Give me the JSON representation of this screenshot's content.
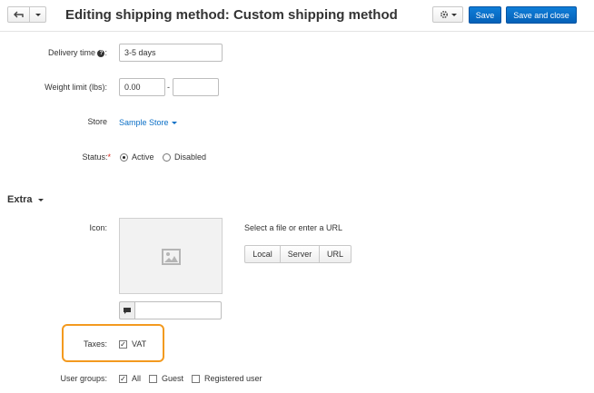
{
  "header": {
    "title": "Editing shipping method: Custom shipping method",
    "back_icon": "back-arrow-icon",
    "dropdown_icon": "chevron-down-icon",
    "settings_icon": "gear-icon",
    "save_label": "Save",
    "save_close_label": "Save and close",
    "accent_color": "#0561b8"
  },
  "form": {
    "delivery_time": {
      "label": "Delivery time",
      "value": "3-5 days",
      "help_icon": "question-icon"
    },
    "weight_limit": {
      "label": "Weight limit (lbs):",
      "from_value": "0.00",
      "separator": "-",
      "to_value": ""
    },
    "store": {
      "label": "Store",
      "value": "Sample Store"
    },
    "status": {
      "label": "Status:",
      "required_mark": "*",
      "options": [
        "Active",
        "Disabled"
      ],
      "selected": "Active"
    }
  },
  "extra": {
    "section_title": "Extra",
    "icon": {
      "label": "Icon:",
      "hint": "Select a file or enter a URL",
      "source_buttons": [
        "Local",
        "Server",
        "URL"
      ],
      "placeholder_icon": "image-icon",
      "alt_icon": "comment-icon",
      "alt_value": ""
    },
    "taxes": {
      "label": "Taxes:",
      "option": "VAT",
      "checked": true,
      "highlight_color": "#f39a1f"
    },
    "user_groups": {
      "label": "User groups:",
      "options": [
        {
          "label": "All",
          "checked": true
        },
        {
          "label": "Guest",
          "checked": false
        },
        {
          "label": "Registered user",
          "checked": false
        }
      ]
    }
  }
}
